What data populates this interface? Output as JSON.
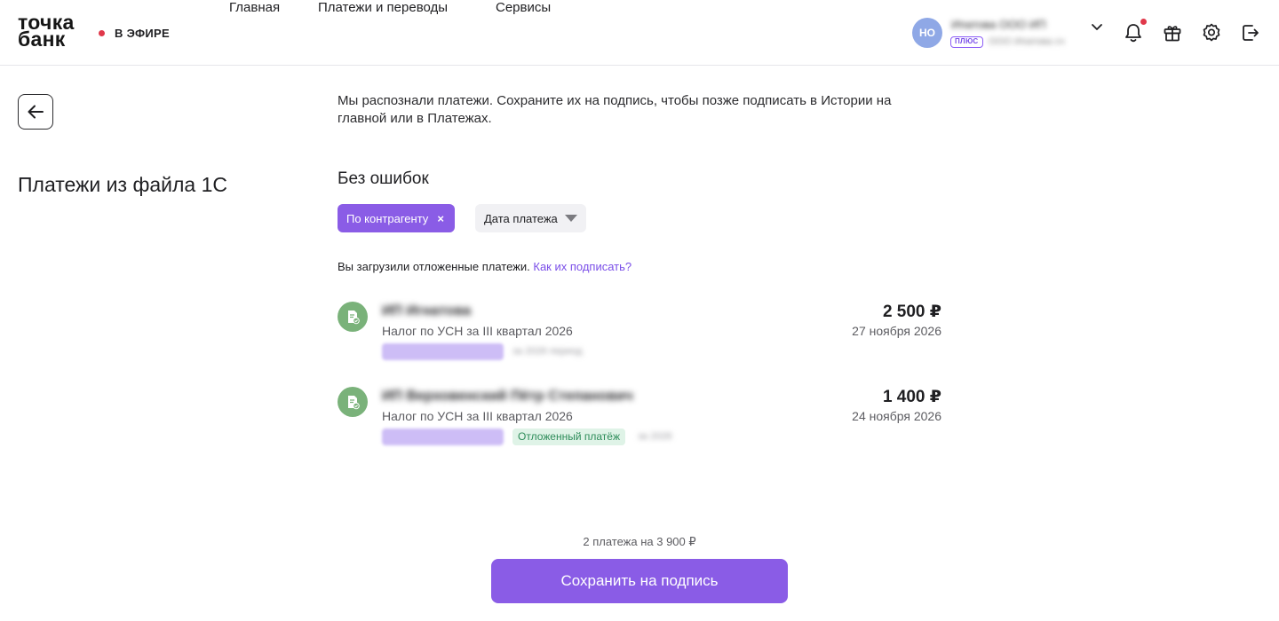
{
  "header": {
    "logo_line1": "точка",
    "logo_line2": "банк",
    "live_label": "В ЭФИРЕ",
    "nav": [
      "Главная",
      "Платежи и переводы",
      "Сервисы"
    ],
    "avatar_initials": "НО",
    "account_name": "Ипатова ООО ИП",
    "account_badge": "ПЛЮС",
    "account_sub": "ООО Ипатова сч"
  },
  "page": {
    "title": "Платежи из файла 1С",
    "intro": "Мы распознали платежи. Сохраните их на подпись, чтобы позже подписать в Истории на главной или в Платежах.",
    "section_title": "Без ошибок",
    "filters": {
      "active_chip": "По контрагенту",
      "active_chip_close": "×",
      "date_chip": "Дата платежа"
    },
    "notice_text": "Вы загрузили отложенные платежи. ",
    "notice_link": "Как их подписать?"
  },
  "payments": [
    {
      "name": "ИП Игнатова",
      "description": "Налог по УСН за III квартал 2026",
      "amount": "2 500 ₽",
      "date": "27 ноября 2026",
      "extra": "за 2026 период",
      "deferred_label": ""
    },
    {
      "name": "ИП Верховенский Пётр Степанович",
      "description": "Налог по УСН за III квартал 2026",
      "amount": "1 400 ₽",
      "date": "24 ноября 2026",
      "extra": "за 2026",
      "deferred_label": "Отложенный платёж"
    }
  ],
  "footer": {
    "summary": "2 платежа на 3 900 ₽",
    "save_button": "Сохранить на подпись"
  },
  "colors": {
    "accent": "#8a5ce6",
    "link": "#7a4ee8",
    "notification_dot": "#e0384a",
    "payment_icon": "#7ab27a",
    "deferred_tag_bg": "#dff3e7"
  }
}
